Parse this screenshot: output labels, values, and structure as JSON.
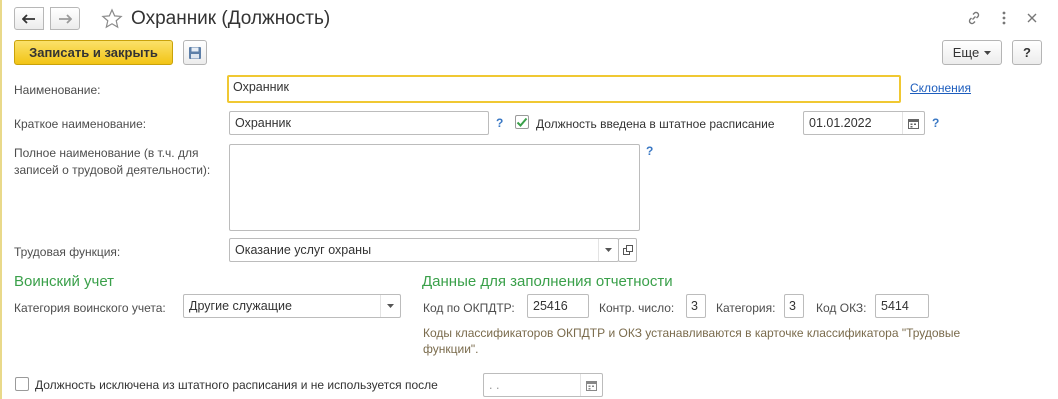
{
  "window": {
    "title": "Охранник (Должность)"
  },
  "toolbar": {
    "save_close_label": "Записать и закрыть",
    "more_label": "Еще",
    "help_label": "?"
  },
  "form": {
    "name": {
      "label": "Наименование:",
      "value": "Охранник"
    },
    "declensions_link": "Склонения",
    "short_name": {
      "label": "Краткое наименование:",
      "value": "Охранник"
    },
    "staff_schedule": {
      "label": "Должность введена в штатное расписание",
      "checked": true,
      "date": "01.01.2022"
    },
    "full_name": {
      "label_line1": "Полное наименование (в т.ч. для",
      "label_line2": "записей о трудовой деятельности):",
      "value": ""
    },
    "labor_function": {
      "label": "Трудовая функция:",
      "value": "Оказание услуг охраны"
    },
    "help_mark": "?"
  },
  "military": {
    "section_title": "Воинский учет",
    "category_label": "Категория воинского учета:",
    "category_value": "Другие служащие"
  },
  "reporting": {
    "section_title": "Данные для заполнения отчетности",
    "okpdtr_label": "Код по ОКПДТР:",
    "okpdtr_value": "25416",
    "control_label": "Контр. число:",
    "control_value": "3",
    "category_label": "Категория:",
    "category_value": "3",
    "okz_label": "Код ОКЗ:",
    "okz_value": "5414",
    "note_line1": "Коды классификаторов ОКПДТР и ОКЗ устанавливаются в карточке классификатора \"Трудовые",
    "note_line2": "функции\"."
  },
  "excluded": {
    "label": "Должность исключена из штатного расписания и не используется после",
    "checked": false,
    "date_placeholder": " .  ."
  },
  "colors": {
    "accent_yellow": "#f2c415",
    "section_green": "#3aa04a",
    "link_blue": "#1d5dbd"
  }
}
